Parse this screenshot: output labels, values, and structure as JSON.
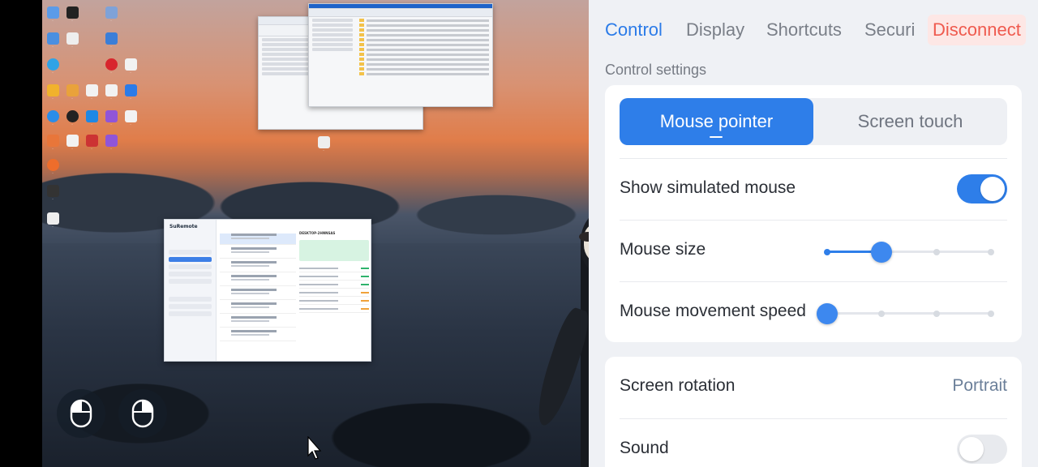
{
  "remote_desktop": {
    "thumbnail_window": {
      "app_name": "SuRemote",
      "device_name": "DESKTOP-2HNNSAS"
    }
  },
  "panel": {
    "tabs": [
      {
        "label": "Control",
        "active": true
      },
      {
        "label": "Display",
        "active": false
      },
      {
        "label": "Shortcuts",
        "active": false
      },
      {
        "label": "Securi",
        "active": false
      }
    ],
    "disconnect_label": "Disconnect",
    "section_title": "Control settings",
    "mode_segment": {
      "options": [
        "Mouse pointer",
        "Screen touch"
      ],
      "selected": "Mouse pointer"
    },
    "show_simulated_mouse": {
      "label": "Show simulated mouse",
      "enabled": true
    },
    "mouse_size": {
      "label": "Mouse size",
      "steps": 4,
      "value_step": 2
    },
    "mouse_speed": {
      "label": "Mouse movement speed",
      "steps": 4,
      "value_step": 1
    },
    "screen_rotation": {
      "label": "Screen rotation",
      "value": "Portrait"
    },
    "sound": {
      "label": "Sound",
      "enabled": false
    }
  },
  "colors": {
    "accent": "#2e7ee9",
    "disconnect": "#ef5a4e",
    "disconnect_bg": "#fde7e5",
    "panel_bg": "#eff1f5"
  },
  "icons": {
    "left_mouse": "mouse-left-click-icon",
    "right_mouse": "mouse-right-click-icon",
    "cursor": "arrow-cursor-icon"
  }
}
